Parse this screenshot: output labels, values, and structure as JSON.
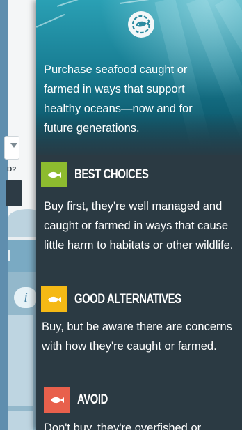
{
  "background_screen": {
    "question_fragment": "D?",
    "info_icon_label": "i"
  },
  "drawer": {
    "logo_icon": "seafood-watch-fish-logo-icon",
    "intro_text": "Purchase seafood caught or farmed in ways that support healthy oceans—now and for future generations.",
    "sections": [
      {
        "title": "BEST CHOICES",
        "color": "#8dbb2f",
        "icon": "fish-icon",
        "description": "Buy first, they're well managed and caught or farmed in ways that cause little harm to habitats or other wildlife."
      },
      {
        "title": "GOOD ALTERNATIVES",
        "color": "#f5b915",
        "icon": "fish-icon",
        "description": "Buy, but be aware there are concerns with how they're caught or farmed."
      },
      {
        "title": "AVOID",
        "color": "#e8604c",
        "icon": "fish-icon",
        "description": "Don't buy, they're overfished or"
      }
    ]
  }
}
